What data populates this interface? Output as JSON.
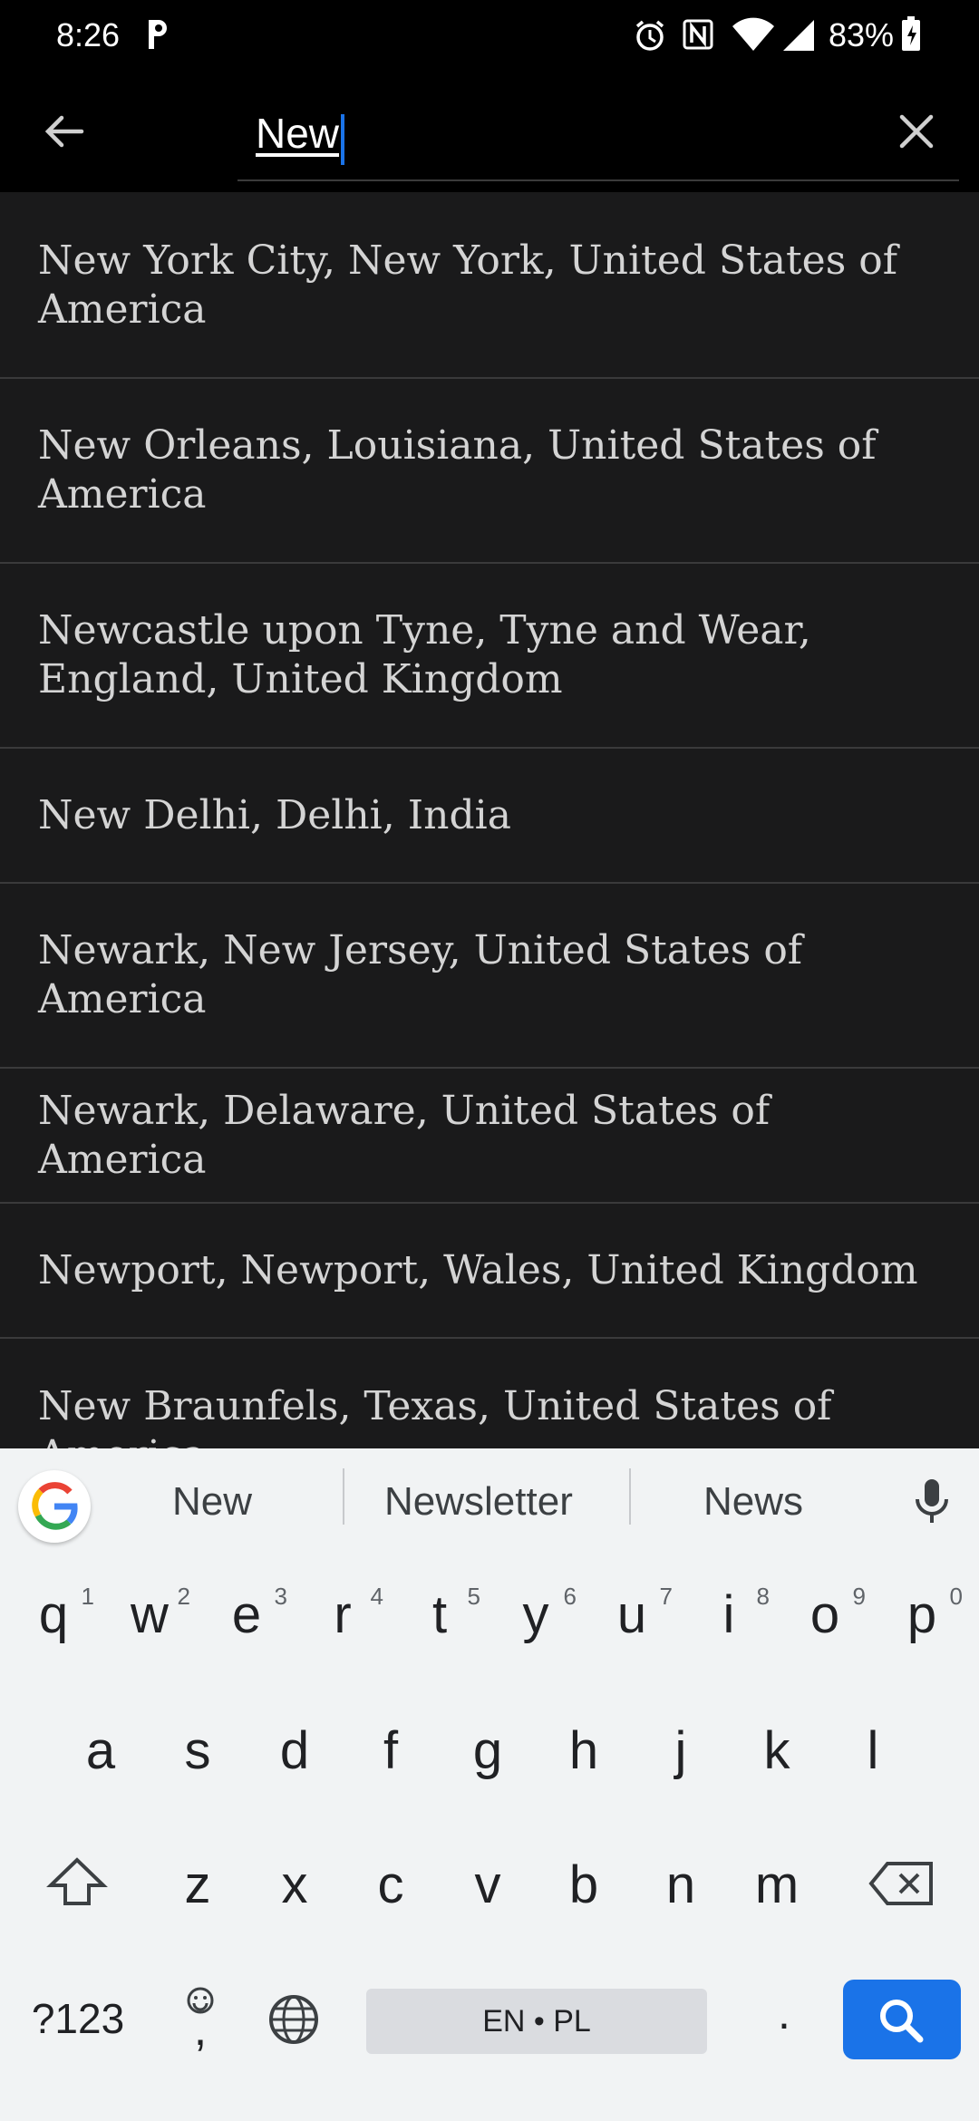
{
  "status": {
    "time": "8:26",
    "battery": "83%"
  },
  "search": {
    "query": "New"
  },
  "results": [
    {
      "label": "New York City, New York, United States of America"
    },
    {
      "label": "New Orleans, Louisiana, United States of America"
    },
    {
      "label": "Newcastle upon Tyne, Tyne and Wear, England, United Kingdom"
    },
    {
      "label": "New Delhi, Delhi, India"
    },
    {
      "label": "Newark, New Jersey, United States of America"
    },
    {
      "label": "Newark, Delaware, United States of America"
    },
    {
      "label": "Newport, Newport, Wales, United Kingdom"
    },
    {
      "label": "New Braunfels, Texas, United States of America"
    }
  ],
  "keyboard": {
    "suggestions": [
      "New",
      "Newsletter",
      "News"
    ],
    "row1": [
      "q",
      "w",
      "e",
      "r",
      "t",
      "y",
      "u",
      "i",
      "o",
      "p"
    ],
    "row1_nums": [
      "1",
      "2",
      "3",
      "4",
      "5",
      "6",
      "7",
      "8",
      "9",
      "0"
    ],
    "row2": [
      "a",
      "s",
      "d",
      "f",
      "g",
      "h",
      "j",
      "k",
      "l"
    ],
    "row3": [
      "z",
      "x",
      "c",
      "v",
      "b",
      "n",
      "m"
    ],
    "symbols_label": "?123",
    "comma": ",",
    "period": ".",
    "space_label": "EN • PL"
  },
  "icons": {
    "back": "arrow-left-icon",
    "clear": "close-icon",
    "mic": "microphone-icon",
    "search": "search-icon"
  }
}
